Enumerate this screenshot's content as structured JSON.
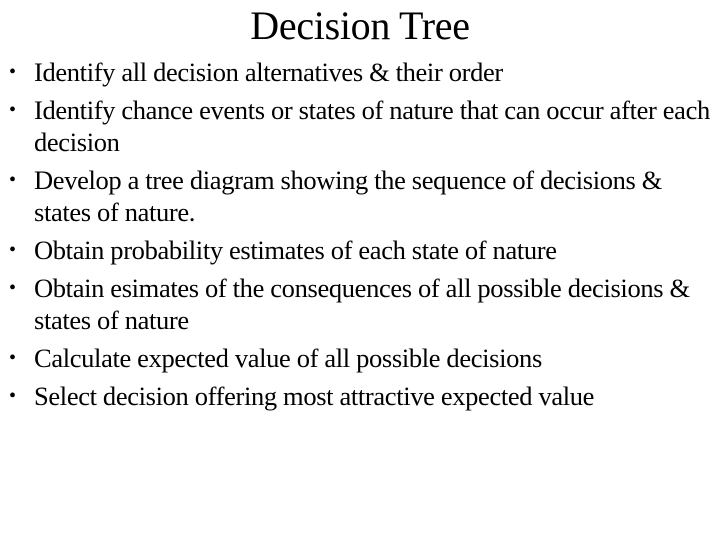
{
  "slide": {
    "title": "Decision Tree",
    "bullet_symbol": "•",
    "bullets": [
      {
        "text": "Identify all decision alternatives & their order"
      },
      {
        "text": "Identify chance events or states of nature that can occur after each decision"
      },
      {
        "text": "Develop a tree diagram showing the sequence of decisions & states of nature."
      },
      {
        "text": "Obtain probability estimates of each state of nature"
      },
      {
        "text": "Obtain esimates of the consequences of all possible decisions & states of nature"
      },
      {
        "text": "Calculate expected value of all possible decisions"
      },
      {
        "text": "Select decision offering most attractive expected value"
      }
    ]
  }
}
